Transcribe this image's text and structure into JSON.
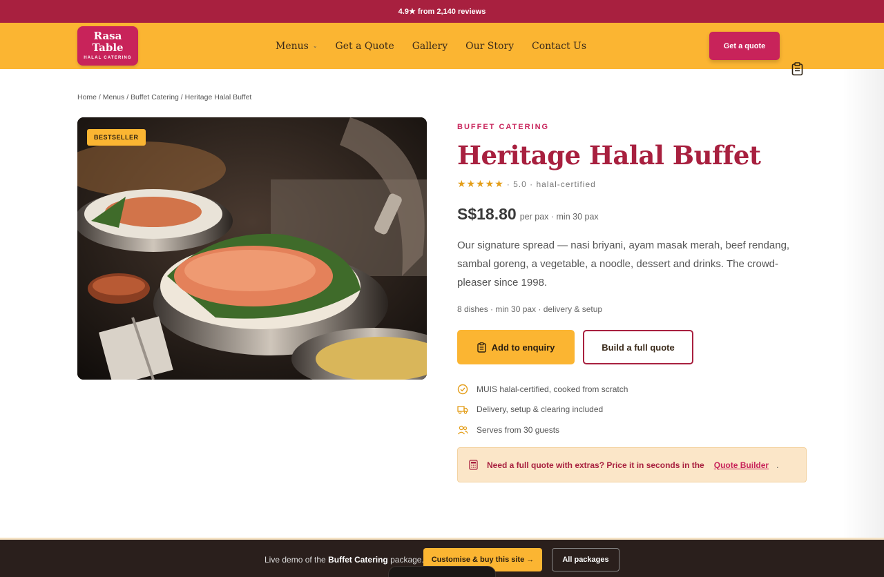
{
  "topbar": {
    "text": "4.9★ from 2,140 reviews"
  },
  "header": {
    "logo_line1": "Rasa",
    "logo_line2": "Table",
    "logo_tagline": "HALAL CATERING",
    "nav": [
      "Menus",
      "Get a Quote",
      "Gallery",
      "Our Story",
      "Contact Us"
    ],
    "cta": "Get a quote"
  },
  "breadcrumb": "Home / Menus / Buffet Catering / Heritage Halal Buffet",
  "hero": {
    "badge": "BESTSELLER"
  },
  "product": {
    "eyebrow": "BUFFET CATERING",
    "title": "Heritage Halal Buffet",
    "stars": "★★★★★",
    "rating_text": "· 5.0 · halal-certified",
    "rating_value": 5.0,
    "price": "S$18.80",
    "price_unit": "per pax · min 30 pax",
    "description": "Our signature spread — nasi briyani, ayam masak merah, beef rendang, sambal goreng, a vegetable, a noodle, dessert and drinks. The crowd-pleaser since 1998.",
    "meta": "8 dishes · min 30 pax · delivery & setup",
    "btn_enquiry": "Add to enquiry",
    "btn_quote": "Build a full quote",
    "features": [
      {
        "icon": "check-circle-icon",
        "text": "MUIS halal-certified, cooked from scratch"
      },
      {
        "icon": "truck-icon",
        "text": "Delivery, setup & clearing included"
      },
      {
        "icon": "users-icon",
        "text": "Serves from 30 guests"
      }
    ],
    "callout_text": "Need a full quote with extras? Price it in seconds in the",
    "callout_link": "Quote Builder",
    "callout_end": "."
  },
  "bottombar": {
    "text_prefix": "Live demo of the",
    "package": "Buffet Catering",
    "text_suffix": "package.",
    "btn_buy": "Customise & buy this site →",
    "btn_all": "All packages"
  },
  "colors": {
    "brand": "#a8203f",
    "accent": "#fbb532",
    "pink": "#c8235a"
  }
}
